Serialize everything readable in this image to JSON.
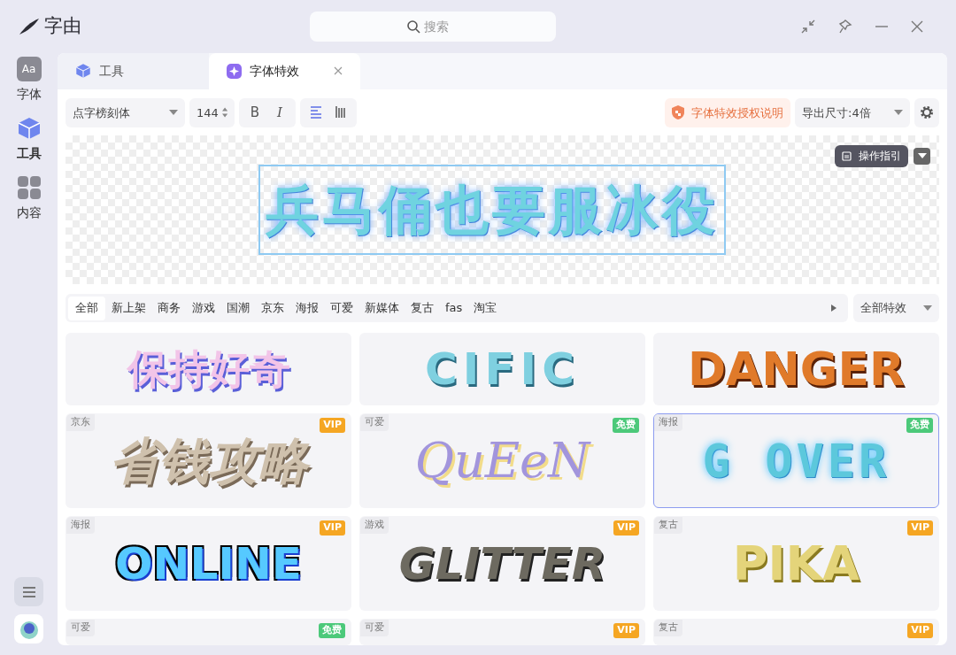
{
  "app": {
    "title": "字由"
  },
  "search": {
    "placeholder": "搜索"
  },
  "sidebar": {
    "items": [
      {
        "label": "字体",
        "icon_text": "Aa",
        "selected": false
      },
      {
        "label": "工具",
        "selected": true
      },
      {
        "label": "内容",
        "selected": false
      }
    ]
  },
  "tabs": [
    {
      "label": "工具",
      "selected": false,
      "closable": false
    },
    {
      "label": "字体特效",
      "selected": true,
      "closable": true
    }
  ],
  "toolbar": {
    "font": "点字榜刻体",
    "size": "144",
    "bold": "B",
    "italic": "I",
    "layouts": [
      {
        "kind": "horizontal",
        "selected": true
      },
      {
        "kind": "vertical",
        "selected": false
      }
    ],
    "license": "字体特效授权说明",
    "export": "导出尺寸:4倍"
  },
  "preview": {
    "text": "兵马俑也要服冰役",
    "guide": "操作指引"
  },
  "categories": [
    {
      "label": "全部",
      "selected": true
    },
    {
      "label": "新上架",
      "selected": false
    },
    {
      "label": "商务",
      "selected": false
    },
    {
      "label": "游戏",
      "selected": false
    },
    {
      "label": "国潮",
      "selected": false
    },
    {
      "label": "京东",
      "selected": false
    },
    {
      "label": "海报",
      "selected": false
    },
    {
      "label": "可爱",
      "selected": false
    },
    {
      "label": "新媒体",
      "selected": false
    },
    {
      "label": "复古",
      "selected": false
    },
    {
      "label": "fas",
      "selected": false
    },
    {
      "label": "淘宝",
      "selected": false
    }
  ],
  "effect_filter": "全部特效",
  "effects": [
    {
      "sample": "保持好奇",
      "selected": false
    },
    {
      "sample": "CIFIC",
      "selected": false
    },
    {
      "sample": "DANGER",
      "selected": false
    },
    {
      "tag": "京东",
      "badge": "VIP",
      "sample": "省钱攻略",
      "selected": false
    },
    {
      "tag": "可爱",
      "badge": "免费",
      "sample": "QuEeN",
      "selected": false
    },
    {
      "tag": "海报",
      "badge": "免费",
      "sample": "G OVER",
      "selected": true
    },
    {
      "tag": "海报",
      "badge": "VIP",
      "sample": "ONLINE",
      "selected": false
    },
    {
      "tag": "游戏",
      "badge": "VIP",
      "sample": "GLITTER",
      "selected": false
    },
    {
      "tag": "复古",
      "badge": "VIP",
      "sample": "PIKA",
      "selected": false
    },
    {
      "tag": "可爱",
      "badge": "免费",
      "selected": false
    },
    {
      "tag": "可爱",
      "badge": "VIP",
      "selected": false
    },
    {
      "tag": "复古",
      "badge": "VIP",
      "selected": false
    }
  ]
}
